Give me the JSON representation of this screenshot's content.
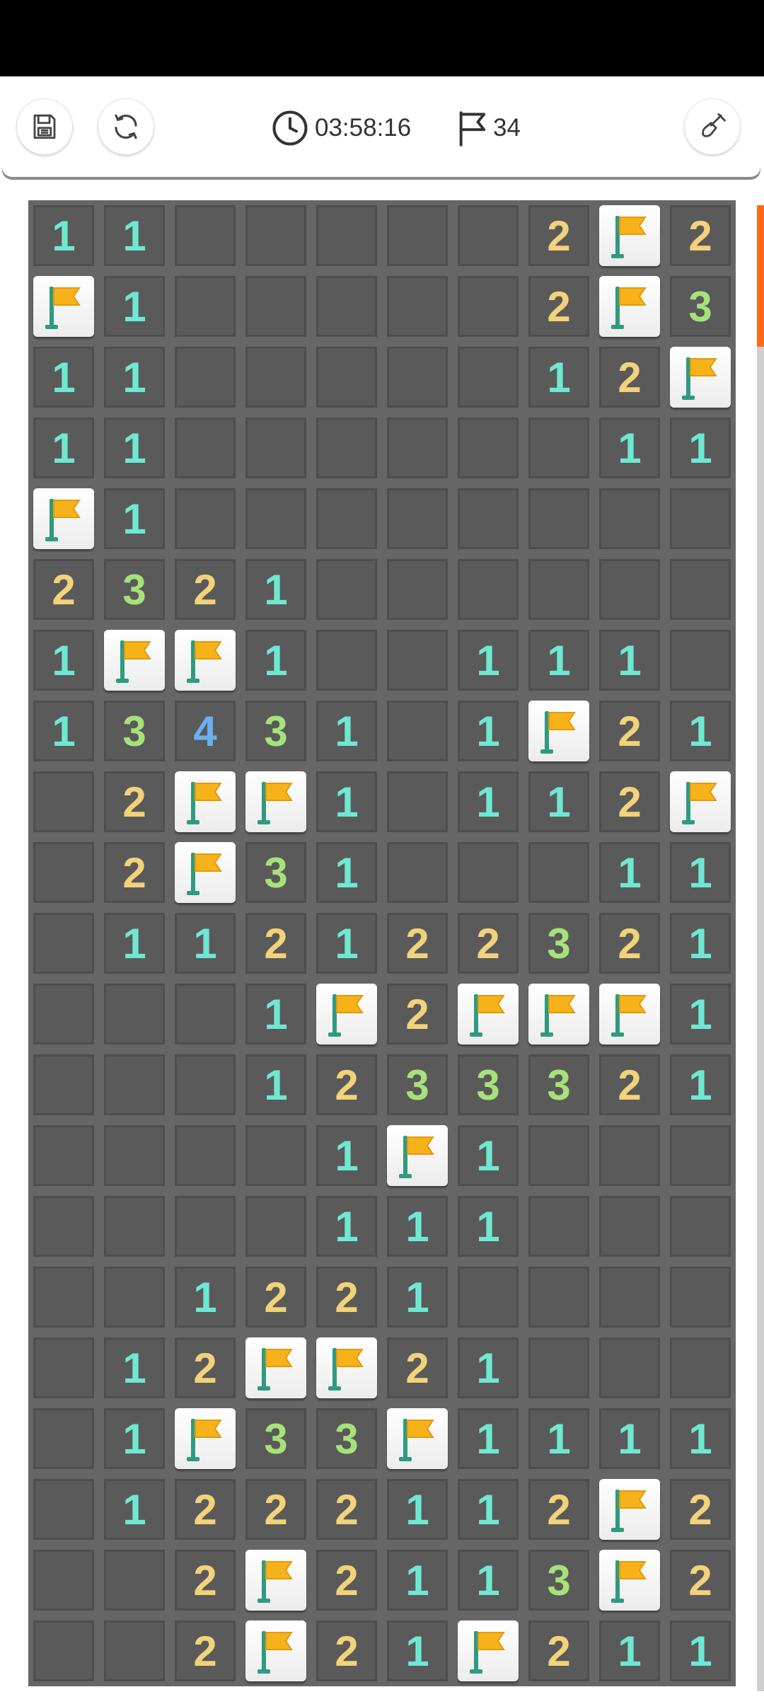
{
  "toolbar": {
    "timer": "03:58:16",
    "flags_remaining": "34"
  },
  "colors": {
    "number_1": "#6fe8d2",
    "number_2": "#f2d27a",
    "number_3": "#a6e27a",
    "number_4": "#6ab0f0",
    "flag": "#f7b21a",
    "scroll_accent": "#ff6a1a"
  },
  "board": {
    "cols": 10,
    "rows": 21,
    "grid": [
      "11.....2F2",
      "F1.....2F3",
      "11.....12F",
      "11......11",
      "F1........",
      "2321......",
      "1FF1..111.",
      "13431.1F21",
      ".2FF1.112F",
      ".2F31...11",
      ".112122321",
      "...1F2FFF1",
      "...1233321",
      "....1F1...",
      "....111...",
      "..1221....",
      ".12FF21...",
      ".1F33F1111",
      ".1222112F2",
      "..2F2113F2",
      "..2F21F211"
    ]
  }
}
